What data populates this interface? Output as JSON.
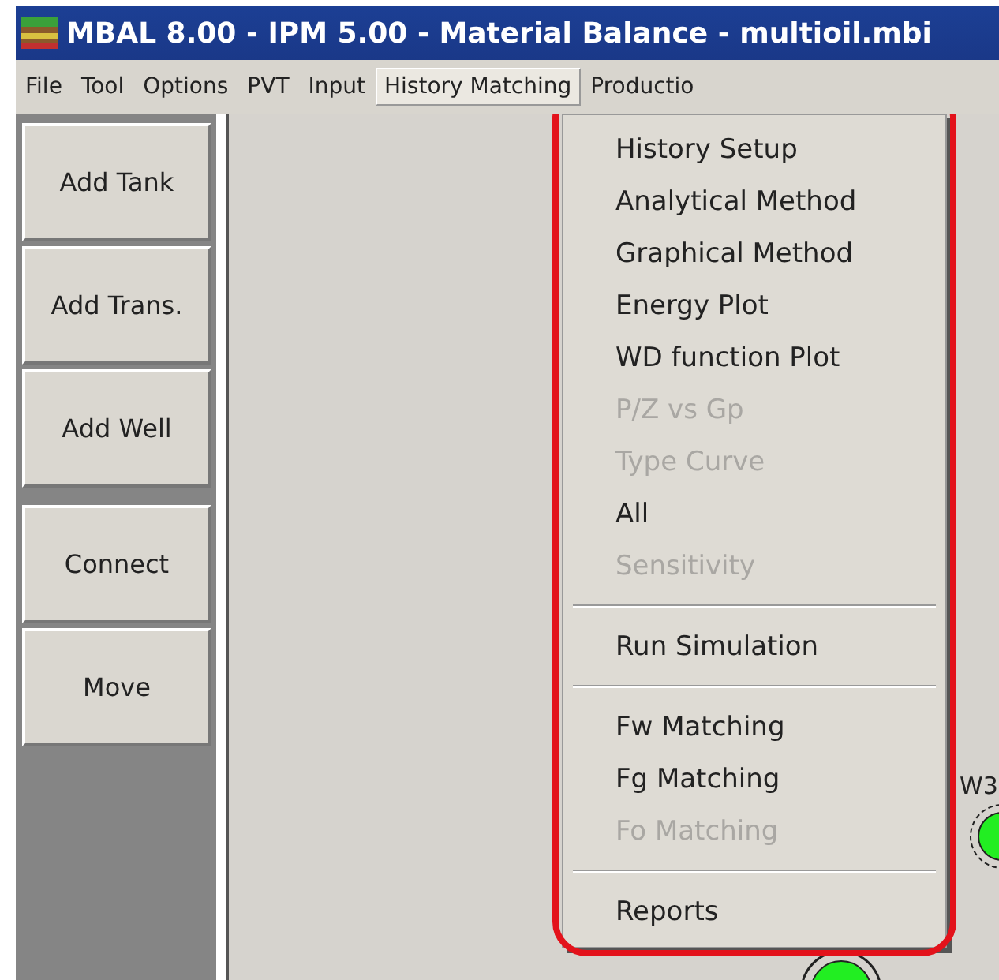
{
  "window": {
    "title": "MBAL 8.00 - IPM 5.00 - Material Balance - multioil.mbi"
  },
  "menu_bar": [
    {
      "label": "File",
      "selected": false
    },
    {
      "label": "Tool",
      "selected": false
    },
    {
      "label": "Options",
      "selected": false
    },
    {
      "label": "PVT",
      "selected": false
    },
    {
      "label": "Input",
      "selected": false
    },
    {
      "label": "History Matching",
      "selected": true
    },
    {
      "label": "Productio",
      "selected": false
    }
  ],
  "toolbox": [
    "Add Tank",
    "Add Trans.",
    "Add Well",
    "Connect",
    "Move"
  ],
  "dropdown": [
    {
      "kind": "item",
      "label": "History Setup",
      "disabled": false
    },
    {
      "kind": "item",
      "label": "Analytical Method",
      "disabled": false
    },
    {
      "kind": "item",
      "label": "Graphical Method",
      "disabled": false
    },
    {
      "kind": "item",
      "label": "Energy Plot",
      "disabled": false
    },
    {
      "kind": "item",
      "label": "WD function Plot",
      "disabled": false
    },
    {
      "kind": "item",
      "label": "P/Z vs Gp",
      "disabled": true
    },
    {
      "kind": "item",
      "label": "Type Curve",
      "disabled": true
    },
    {
      "kind": "item",
      "label": "All",
      "disabled": false
    },
    {
      "kind": "item",
      "label": "Sensitivity",
      "disabled": true
    },
    {
      "kind": "separator"
    },
    {
      "kind": "item",
      "label": "Run Simulation",
      "disabled": false
    },
    {
      "kind": "separator"
    },
    {
      "kind": "item",
      "label": "Fw Matching",
      "disabled": false
    },
    {
      "kind": "item",
      "label": "Fg Matching",
      "disabled": false
    },
    {
      "kind": "item",
      "label": "Fo Matching",
      "disabled": true
    },
    {
      "kind": "separator"
    },
    {
      "kind": "item",
      "label": "Reports",
      "disabled": false
    }
  ],
  "canvas": {
    "node_label": "W3"
  }
}
